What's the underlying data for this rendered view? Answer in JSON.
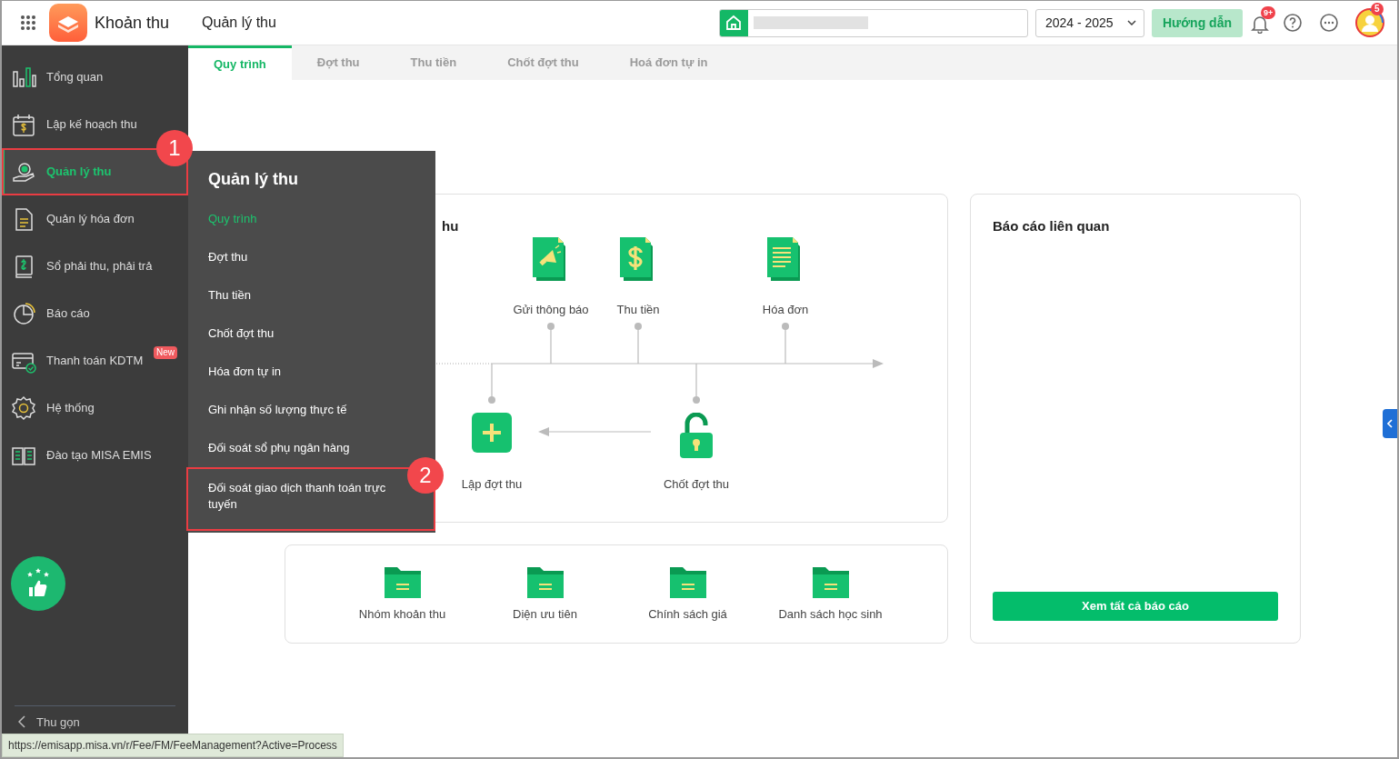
{
  "header": {
    "app_name": "Khoản thu",
    "page_title": "Quản lý thu",
    "year_select": {
      "value": "2024 - 2025"
    },
    "guide_button": "Hướng dẫn",
    "notification_badge": "9+",
    "avatar_badge": "5"
  },
  "sidebar": {
    "items": [
      {
        "label": "Tổng quan",
        "selected": false
      },
      {
        "label": "Lập kế hoạch thu",
        "selected": false
      },
      {
        "label": "Quản lý thu",
        "selected": true,
        "callout": "1"
      },
      {
        "label": "Quản lý hóa đơn",
        "selected": false
      },
      {
        "label": "Sổ phải thu, phải trả",
        "selected": false
      },
      {
        "label": "Báo cáo",
        "selected": false
      },
      {
        "label": "Thanh toán KDTM",
        "selected": false,
        "badge": "New"
      },
      {
        "label": "Hệ thống",
        "selected": false
      },
      {
        "label": "Đào tạo MISA EMIS",
        "selected": false
      }
    ],
    "collapse": "Thu gọn"
  },
  "tabs": [
    {
      "label": "Quy trình",
      "selected": true
    },
    {
      "label": "Đợt thu",
      "selected": false
    },
    {
      "label": "Thu tiền",
      "selected": false
    },
    {
      "label": "Chốt đợt thu",
      "selected": false
    },
    {
      "label": "Hoá đơn tự in",
      "selected": false
    }
  ],
  "flyout_menu": {
    "title": "Quản lý thu",
    "items": [
      {
        "label": "Quy trình",
        "selected": true
      },
      {
        "label": "Đợt thu",
        "selected": false
      },
      {
        "label": "Thu tiền",
        "selected": false
      },
      {
        "label": "Chốt đợt thu",
        "selected": false
      },
      {
        "label": "Hóa đơn tự in",
        "selected": false
      },
      {
        "label": "Ghi nhận số lượng thực tế",
        "selected": false
      },
      {
        "label": "Đối soát sổ phụ ngân hàng",
        "selected": false
      },
      {
        "label": "Đối soát giao dịch thanh toán trực tuyến",
        "selected": false,
        "callout": "2"
      }
    ]
  },
  "process": {
    "title": "hu",
    "steps": [
      "Gửi thông báo",
      "Thu tiền",
      "Hóa đơn",
      "Lập đợt thu",
      "Chốt đợt thu"
    ]
  },
  "shortcuts": [
    "Nhóm khoản thu",
    "Diện ưu tiên",
    "Chính sách giá",
    "Danh sách học sinh"
  ],
  "reports": {
    "title": "Báo cáo liên quan",
    "button": "Xem tất cả báo cáo"
  },
  "status_url": "https://emisapp.misa.vn/r/Fee/FM/FeeManagement?Active=Process"
}
